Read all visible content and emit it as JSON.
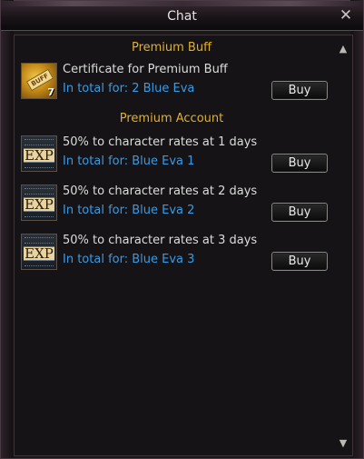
{
  "window": {
    "title": "Chat",
    "close_icon": "close-icon"
  },
  "sections": [
    {
      "title": "Premium Buff",
      "items": [
        {
          "icon": "buff-certificate-icon",
          "icon_tag": "BUFF",
          "icon_count": "7",
          "name": "Certificate for Premium Buff",
          "price": "In total for: 2 Blue Eva",
          "buy_label": "Buy"
        }
      ]
    },
    {
      "title": "Premium Account",
      "items": [
        {
          "icon": "exp-icon",
          "icon_text": "EXP",
          "name": "50% to character rates at 1 days",
          "price": "In total for: Blue Eva 1",
          "buy_label": "Buy"
        },
        {
          "icon": "exp-icon",
          "icon_text": "EXP",
          "name": "50% to character rates at 2 days",
          "price": "In total for: Blue Eva 2",
          "buy_label": "Buy"
        },
        {
          "icon": "exp-icon",
          "icon_text": "EXP",
          "name": "50% to character rates at 3 days",
          "price": "In total for: Blue Eva 3",
          "buy_label": "Buy"
        }
      ]
    }
  ],
  "colors": {
    "section_title": "#e0b030",
    "price_text": "#3a9ae6",
    "panel_background": "#151315"
  }
}
